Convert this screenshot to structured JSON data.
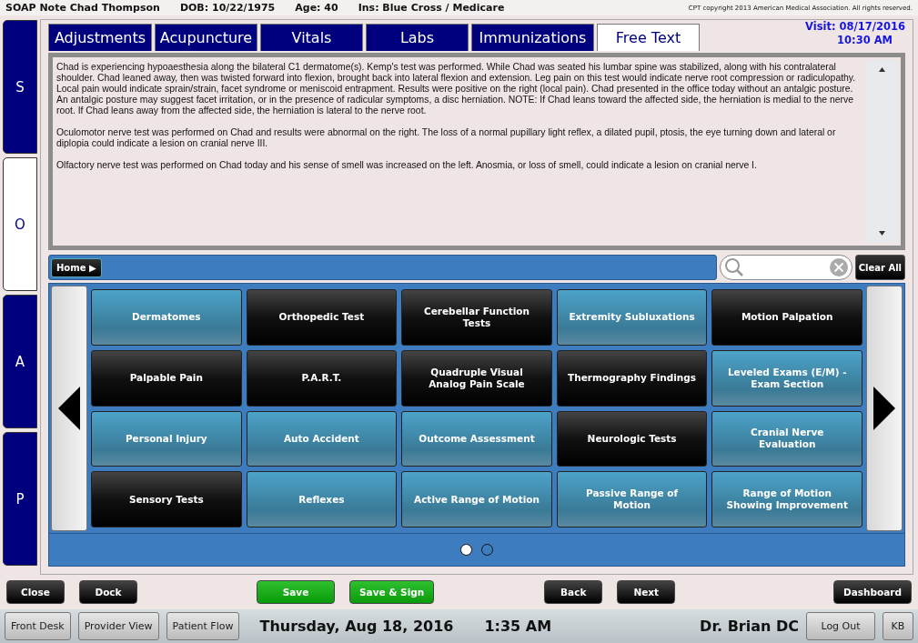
{
  "header": {
    "patient": "SOAP Note Chad Thompson",
    "dob": "DOB: 10/22/1975",
    "age": "Age: 40",
    "insurance": "Ins: Blue Cross / Medicare",
    "copyright": "CPT copyright 2013 American Medical Association. All rights reserved."
  },
  "soap_tabs": [
    {
      "label": "S",
      "selected": false
    },
    {
      "label": "O",
      "selected": true
    },
    {
      "label": "A",
      "selected": false
    },
    {
      "label": "P",
      "selected": false
    }
  ],
  "tabs": [
    {
      "label": "Adjustments",
      "selected": false
    },
    {
      "label": "Acupuncture",
      "selected": false
    },
    {
      "label": "Vitals",
      "selected": false
    },
    {
      "label": "Labs",
      "selected": false
    },
    {
      "label": "Immunizations",
      "selected": false
    },
    {
      "label": "Free Text",
      "selected": true
    }
  ],
  "visit": {
    "date": "Visit: 08/17/2016",
    "time": "10:30 AM"
  },
  "note_paragraphs": [
    "Chad is experiencing hypoaesthesia along the bilateral C1 dermatome(s). Kemp's test was performed.  While Chad was seated his lumbar spine was stabilized, along with his contralateral shoulder.  Chad leaned away, then was twisted forward into flexion, brought back into lateral flexion and extension.  Leg pain on this test would indicate nerve root compression or radiculopathy.  Local pain would indicate sprain/strain, facet syndrome or meniscoid entrapment.  Results were positive on the right (local pain). Chad presented in the office today without an antalgic posture.  An antalgic posture may suggest facet irritation, or in the presence of radicular symptoms, a disc herniation.  NOTE:  If Chad leans toward the affected side, the herniation is medial to the nerve root.  If Chad leans away from the affected side, the herniation is lateral to the nerve root.",
    "Oculomotor nerve test was performed on Chad and results were abnormal on the right.  The loss of a normal pupillary light reflex, a dilated pupil, ptosis, the eye turning down and lateral or diplopia could indicate a lesion on cranial nerve III.",
    "Olfactory nerve test was performed on Chad today and his sense of smell was increased on the left.   Anosmia, or loss of smell, could indicate a lesion on cranial nerve I."
  ],
  "toolbar": {
    "home": "Home ▶",
    "clear": "Clear All"
  },
  "tiles": [
    {
      "label": "Dermatomes",
      "kind": "teal"
    },
    {
      "label": "Orthopedic Test",
      "kind": "dark"
    },
    {
      "label": "Cerebellar Function Tests",
      "kind": "dark"
    },
    {
      "label": "Extremity Subluxations",
      "kind": "teal"
    },
    {
      "label": "Motion Palpation",
      "kind": "dark"
    },
    {
      "label": "Palpable Pain",
      "kind": "dark"
    },
    {
      "label": "P.A.R.T.",
      "kind": "dark"
    },
    {
      "label": "Quadruple Visual Analog Pain Scale",
      "kind": "dark"
    },
    {
      "label": "Thermography Findings",
      "kind": "dark"
    },
    {
      "label": "Leveled Exams (E/M) - Exam Section",
      "kind": "teal"
    },
    {
      "label": "Personal Injury",
      "kind": "teal"
    },
    {
      "label": "Auto Accident",
      "kind": "teal"
    },
    {
      "label": "Outcome Assessment",
      "kind": "teal"
    },
    {
      "label": "Neurologic Tests",
      "kind": "dark"
    },
    {
      "label": "Cranial Nerve Evaluation",
      "kind": "teal"
    },
    {
      "label": "Sensory Tests",
      "kind": "dark"
    },
    {
      "label": "Reflexes",
      "kind": "teal"
    },
    {
      "label": "Active Range of Motion",
      "kind": "teal"
    },
    {
      "label": "Passive Range of Motion",
      "kind": "teal"
    },
    {
      "label": "Range of Motion Showing Improvement",
      "kind": "teal"
    }
  ],
  "pages": [
    {
      "selected": true
    },
    {
      "selected": false
    }
  ],
  "action_bar": {
    "left": [
      {
        "label": "Close",
        "kind": "dark"
      },
      {
        "label": "Dock",
        "kind": "dark"
      }
    ],
    "center": [
      {
        "label": "Save",
        "kind": "green"
      },
      {
        "label": "Save & Sign",
        "kind": "green"
      }
    ],
    "nav": [
      {
        "label": "Back",
        "kind": "dark"
      },
      {
        "label": "Next",
        "kind": "dark"
      }
    ],
    "right": [
      {
        "label": "Dashboard",
        "kind": "dark"
      }
    ]
  },
  "status_bar": {
    "buttons": [
      "Front Desk",
      "Provider View",
      "Patient Flow"
    ],
    "date": "Thursday, Aug 18, 2016",
    "time": "1:35 AM",
    "user": "Dr. Brian DC",
    "logout": "Log Out",
    "kb": "KB"
  }
}
